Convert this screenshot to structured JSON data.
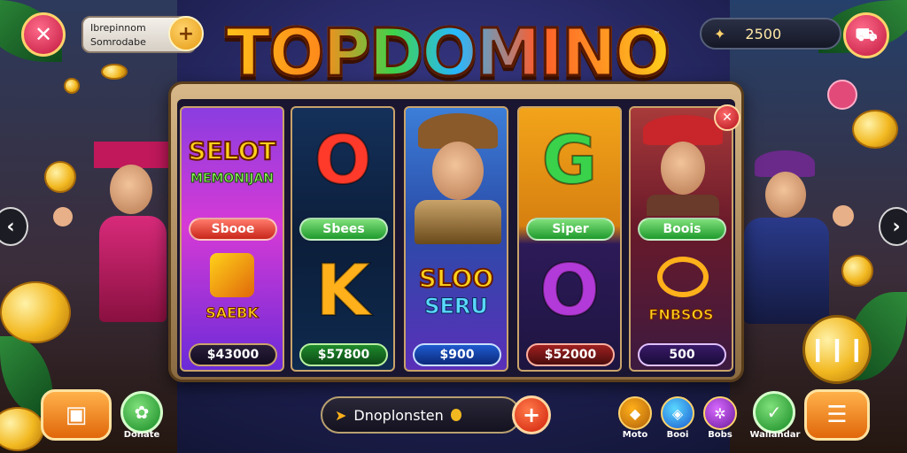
{
  "logo": {
    "text": "TOPDOMINO",
    "trademark": "™"
  },
  "top_left": {
    "player_line1": "Ibrepinnom",
    "player_line2": "Somrodabe"
  },
  "coins": {
    "value": "2500"
  },
  "reels": [
    {
      "top_text_1": "SELOT",
      "top_text_2": "MEMONIJAN",
      "pill": "Sbooe",
      "symbol": "SAEBK",
      "bet": "$43000"
    },
    {
      "letter_top": "O",
      "pill": "Sbees",
      "letter_bottom": "K",
      "bet": "$57800"
    },
    {
      "pill": "",
      "text_1": "SLOO",
      "text_2": "SERU",
      "bet": "$900"
    },
    {
      "letter_top": "G",
      "pill": "Siper",
      "letter_bottom": "O",
      "bet": "$52000"
    },
    {
      "pill": "Boois",
      "symbol": "FNBSOS",
      "bet": "500"
    }
  ],
  "bottom": {
    "donate_label": "Donate",
    "search_text": "Dnoplonsten",
    "icons": [
      {
        "label": "Moto"
      },
      {
        "label": "Booi"
      },
      {
        "label": "Bobs"
      }
    ],
    "wallet_label": "Wallandar"
  },
  "colors": {
    "accent_pink": "#c0183e",
    "accent_orange": "#e0670a",
    "accent_green": "#168a24",
    "frame": "#d8b888"
  }
}
